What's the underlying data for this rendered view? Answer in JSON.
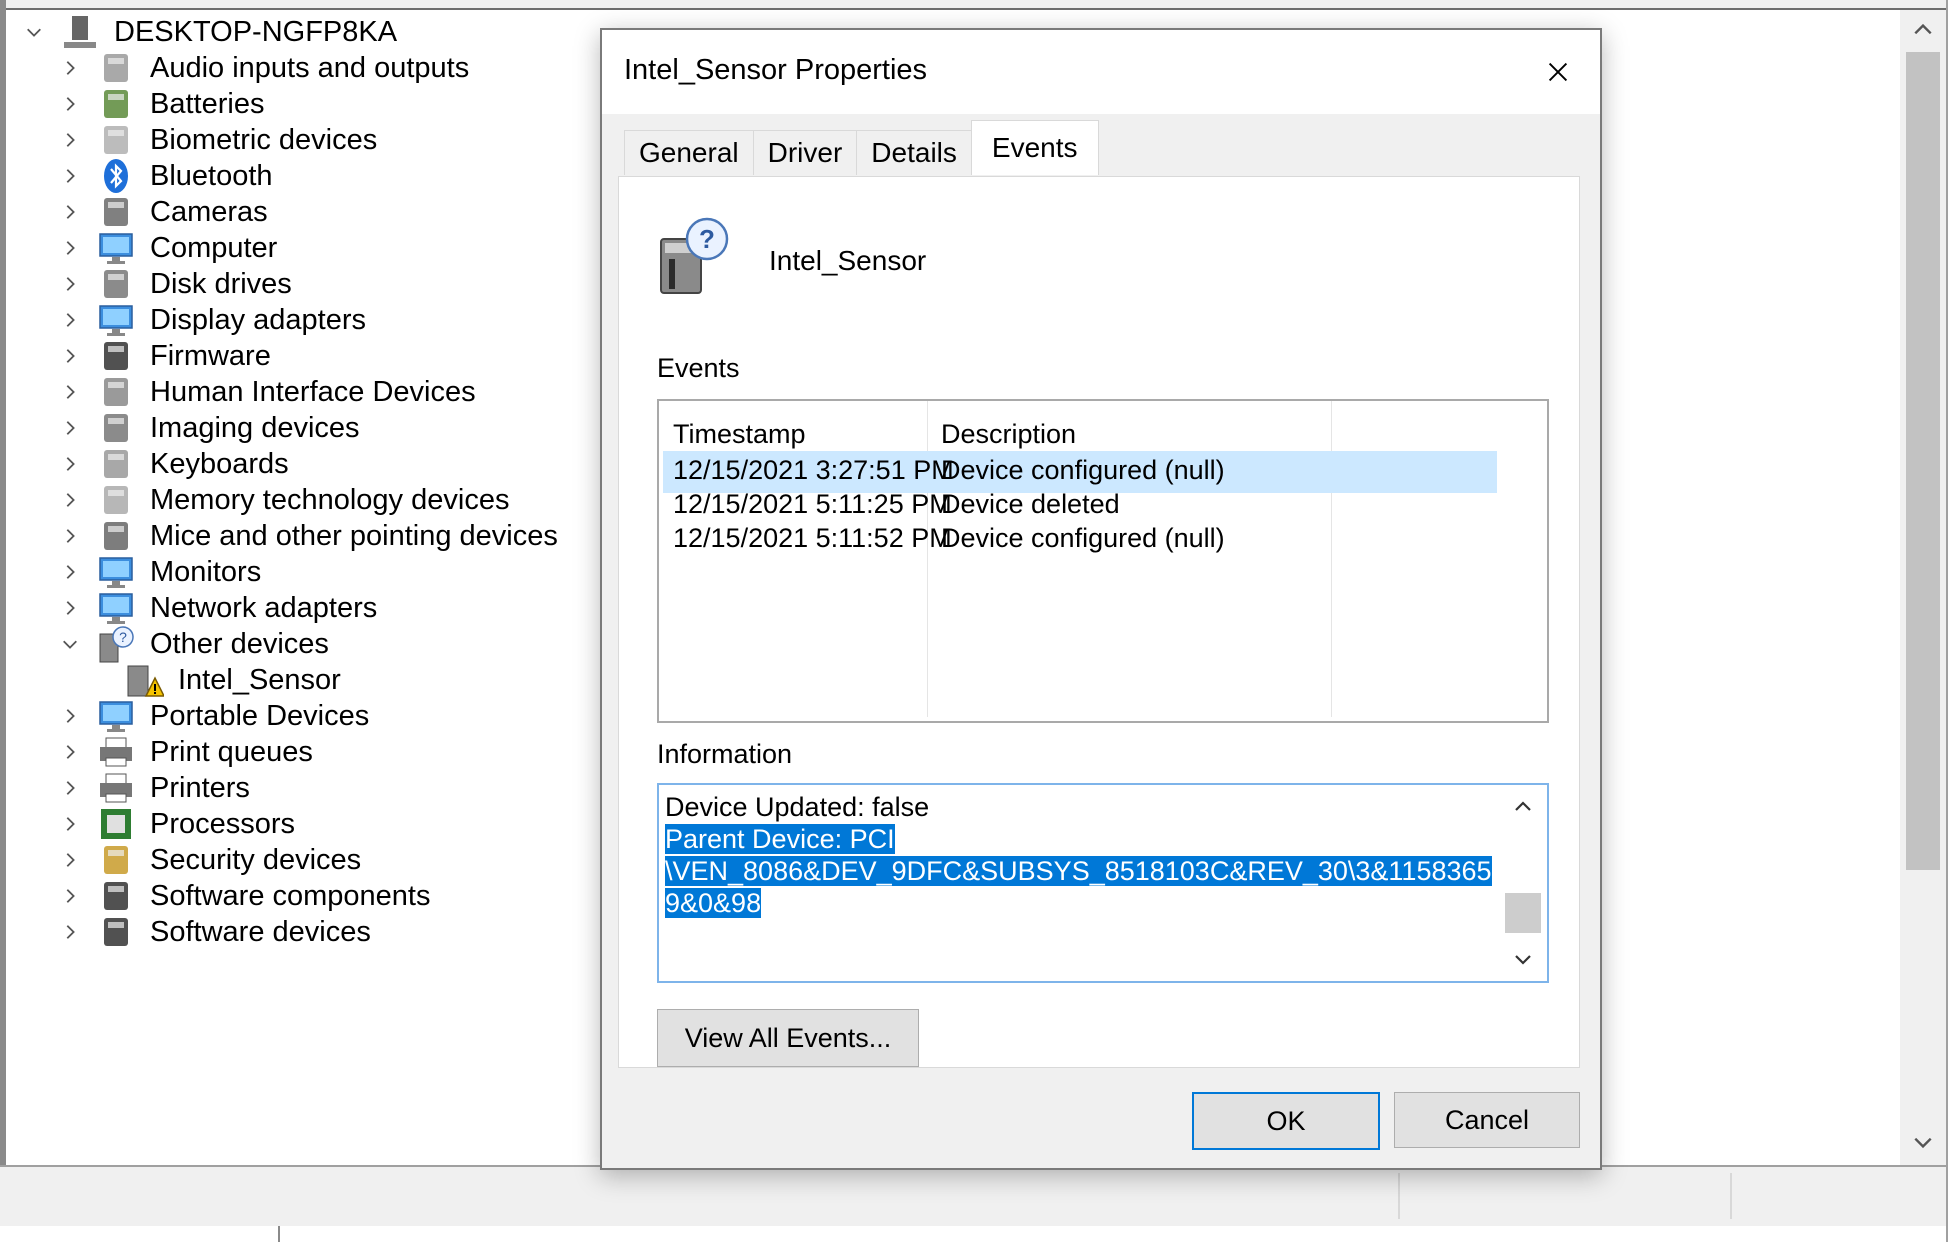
{
  "tree": {
    "root": "DESKTOP-NGFP8KA",
    "items": [
      {
        "label": "Audio inputs and outputs",
        "icon": "speaker-icon",
        "expanded": false
      },
      {
        "label": "Batteries",
        "icon": "battery-icon",
        "expanded": false
      },
      {
        "label": "Biometric devices",
        "icon": "fingerprint-icon",
        "expanded": false
      },
      {
        "label": "Bluetooth",
        "icon": "bluetooth-icon",
        "expanded": false
      },
      {
        "label": "Cameras",
        "icon": "camera-icon",
        "expanded": false
      },
      {
        "label": "Computer",
        "icon": "computer-icon",
        "expanded": false
      },
      {
        "label": "Disk drives",
        "icon": "disk-drive-icon",
        "expanded": false
      },
      {
        "label": "Display adapters",
        "icon": "display-adapter-icon",
        "expanded": false
      },
      {
        "label": "Firmware",
        "icon": "firmware-icon",
        "expanded": false
      },
      {
        "label": "Human Interface Devices",
        "icon": "hid-icon",
        "expanded": false
      },
      {
        "label": "Imaging devices",
        "icon": "scanner-icon",
        "expanded": false
      },
      {
        "label": "Keyboards",
        "icon": "keyboard-icon",
        "expanded": false
      },
      {
        "label": "Memory technology devices",
        "icon": "memory-icon",
        "expanded": false
      },
      {
        "label": "Mice and other pointing devices",
        "icon": "mouse-icon",
        "expanded": false
      },
      {
        "label": "Monitors",
        "icon": "monitor-icon",
        "expanded": false
      },
      {
        "label": "Network adapters",
        "icon": "network-icon",
        "expanded": false
      },
      {
        "label": "Other devices",
        "icon": "unknown-device-icon",
        "expanded": true
      },
      {
        "label": "Intel_Sensor",
        "icon": "warning-device-icon",
        "child": true
      },
      {
        "label": "Portable Devices",
        "icon": "portable-device-icon",
        "expanded": false
      },
      {
        "label": "Print queues",
        "icon": "printer-icon",
        "expanded": false
      },
      {
        "label": "Printers",
        "icon": "printer-icon",
        "expanded": false
      },
      {
        "label": "Processors",
        "icon": "processor-icon",
        "expanded": false
      },
      {
        "label": "Security devices",
        "icon": "security-key-icon",
        "expanded": false
      },
      {
        "label": "Software components",
        "icon": "software-component-icon",
        "expanded": false
      },
      {
        "label": "Software devices",
        "icon": "software-device-icon",
        "expanded": false
      }
    ]
  },
  "dialog": {
    "title": "Intel_Sensor Properties",
    "tabs": [
      "General",
      "Driver",
      "Details",
      "Events"
    ],
    "active_tab": "Events",
    "device_name": "Intel_Sensor",
    "events_label": "Events",
    "columns": [
      "Timestamp",
      "Description"
    ],
    "rows": [
      {
        "timestamp": "12/15/2021 3:27:51 PM",
        "description": "Device configured (null)",
        "selected": true
      },
      {
        "timestamp": "12/15/2021 5:11:25 PM",
        "description": "Device deleted",
        "selected": false
      },
      {
        "timestamp": "12/15/2021 5:11:52 PM",
        "description": "Device configured (null)",
        "selected": false
      }
    ],
    "information_label": "Information",
    "information": {
      "line1": "Device Updated: false",
      "sel1": "Parent Device: PCI",
      "sel2": "\\VEN_8086&DEV_9DFC&SUBSYS_8518103C&REV_30\\3&1158365",
      "sel3": "9&0&98"
    },
    "view_all_label": "View All Events...",
    "ok_label": "OK",
    "cancel_label": "Cancel"
  },
  "colors": {
    "selection": "#0078d7",
    "row_highlight": "#cce8ff",
    "dialog_bg": "#f0f0f0"
  }
}
